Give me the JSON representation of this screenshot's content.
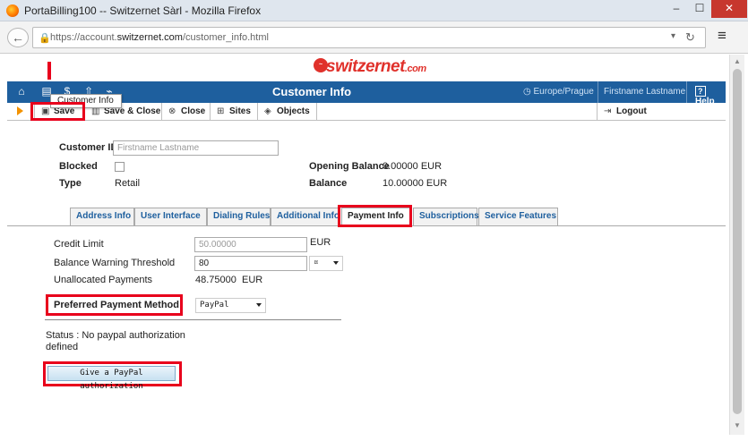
{
  "window": {
    "title": "PortaBilling100 -- Switzernet Sàrl - Mozilla Firefox",
    "minimize": "–",
    "maximize": "☐",
    "close": "✕"
  },
  "browser": {
    "url_prefix": "https://account.",
    "url_domain": "switzernet.com",
    "url_path": "/customer_info.html",
    "back_icon": "left-arrow-icon",
    "menu_icon": "hamburger-icon"
  },
  "logo": {
    "text": "switzernet",
    "tld": ".com"
  },
  "header": {
    "title": "Customer Info",
    "timezone": "Europe/Prague",
    "user": "Firstname Lastname",
    "help": "Help",
    "icons": [
      "home-icon",
      "customer-info-icon",
      "billing-icon",
      "upload-icon",
      "chart-icon"
    ]
  },
  "tooltip": "Customer Info",
  "toolbar": {
    "save": "Save",
    "save_close": "Save & Close",
    "close": "Close",
    "sites": "Sites",
    "objects": "Objects",
    "logout": "Logout"
  },
  "customer": {
    "id_label": "Customer ID",
    "id_placeholder": "Firstname Lastname",
    "blocked_label": "Blocked",
    "blocked": false,
    "type_label": "Type",
    "type_value": "Retail",
    "opening_balance_label": "Opening Balance",
    "opening_balance_value": "0.00000 EUR",
    "balance_label": "Balance",
    "balance_value": "10.00000 EUR"
  },
  "tabs": [
    {
      "label": "Address Info",
      "active": false
    },
    {
      "label": "User Interface",
      "active": false
    },
    {
      "label": "Dialing Rules",
      "active": false
    },
    {
      "label": "Additional Info",
      "active": false
    },
    {
      "label": "Payment Info",
      "active": true
    },
    {
      "label": "Subscriptions",
      "active": false
    },
    {
      "label": "Service Features",
      "active": false
    }
  ],
  "payment": {
    "credit_limit_label": "Credit Limit",
    "credit_limit_value": "50.00000",
    "credit_limit_unit": "EUR",
    "balance_warning_label": "Balance Warning Threshold",
    "balance_warning_value": "80",
    "balance_warning_unit": "¤",
    "unallocated_label": "Unallocated Payments",
    "unallocated_value": "48.75000",
    "unallocated_unit": "EUR",
    "preferred_method_label": "Preferred Payment Method",
    "preferred_method_value": "PayPal",
    "status_line1": "Status : No paypal authorization",
    "status_line2": "defined",
    "paypal_button": "Give a PayPal authorization"
  },
  "colors": {
    "header_blue": "#1e5f9e",
    "highlight_red": "#e8001c",
    "toolbar_arrow": "#f39200"
  }
}
